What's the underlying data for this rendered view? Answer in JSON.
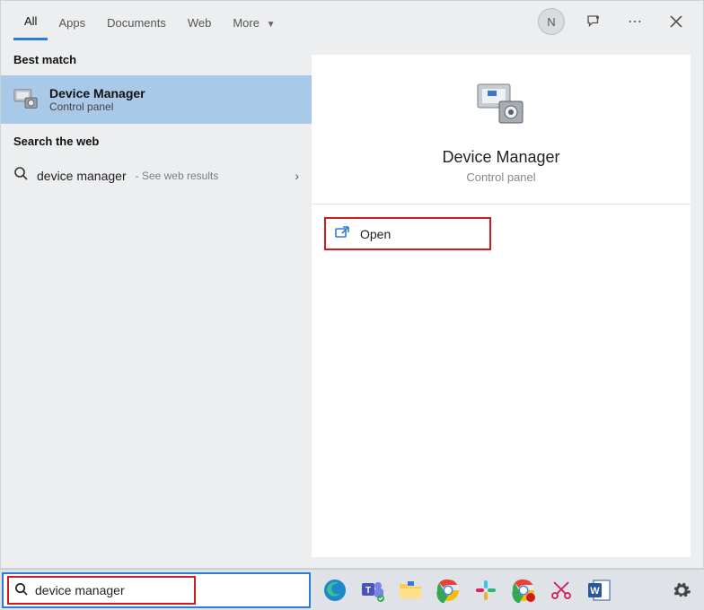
{
  "tabs": {
    "items": [
      {
        "label": "All",
        "active": true
      },
      {
        "label": "Apps",
        "active": false
      },
      {
        "label": "Documents",
        "active": false
      },
      {
        "label": "Web",
        "active": false
      },
      {
        "label": "More",
        "active": false,
        "dropdown": true
      }
    ]
  },
  "header": {
    "avatar_initial": "N"
  },
  "left": {
    "best_match_label": "Best match",
    "best": {
      "title": "Device Manager",
      "subtitle": "Control panel"
    },
    "search_web_label": "Search the web",
    "web": {
      "query": "device manager",
      "hint": " - See web results"
    }
  },
  "right": {
    "title": "Device Manager",
    "subtitle": "Control panel",
    "open_label": "Open"
  },
  "search": {
    "value": "device manager"
  }
}
